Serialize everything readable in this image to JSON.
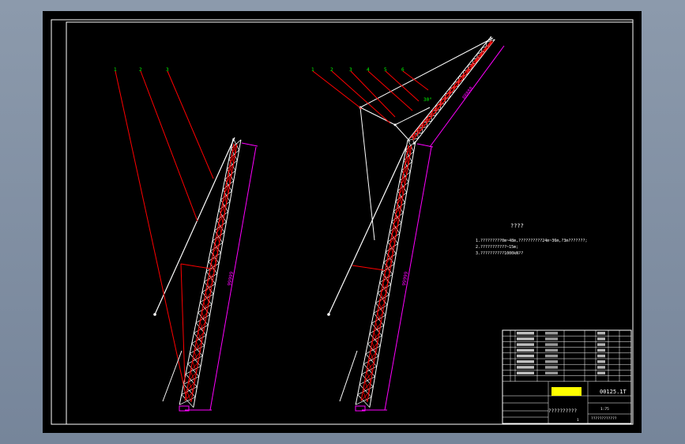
{
  "drawing": {
    "colors": {
      "background": "#000000",
      "frame": "#ffffff",
      "leader": "#ff0000",
      "dimension": "#ff00ff",
      "callout": "#00ff00",
      "truss": "#ffffff",
      "titleblock": "#ffffff",
      "logo": "#ffff00"
    },
    "left_view": {
      "callouts": [
        "1",
        "2",
        "3"
      ],
      "length_dim": "99999"
    },
    "right_view": {
      "callouts": [
        "1",
        "2",
        "3",
        "4",
        "5",
        "6"
      ],
      "angle_label": "30°",
      "length_dim": "99999",
      "upper_dim": "88888"
    },
    "notes": {
      "heading": "????",
      "line1": "1.?????????0m~48m,??????????24m~36m,?3m???????;",
      "line2": "2.???????????~15m;",
      "line3": "3.??????????1000kN??"
    },
    "title_block": {
      "drawing_number": "00125.1T",
      "name": "??????????",
      "project": "????????????",
      "scale": "1:75",
      "sheet": "1"
    }
  }
}
